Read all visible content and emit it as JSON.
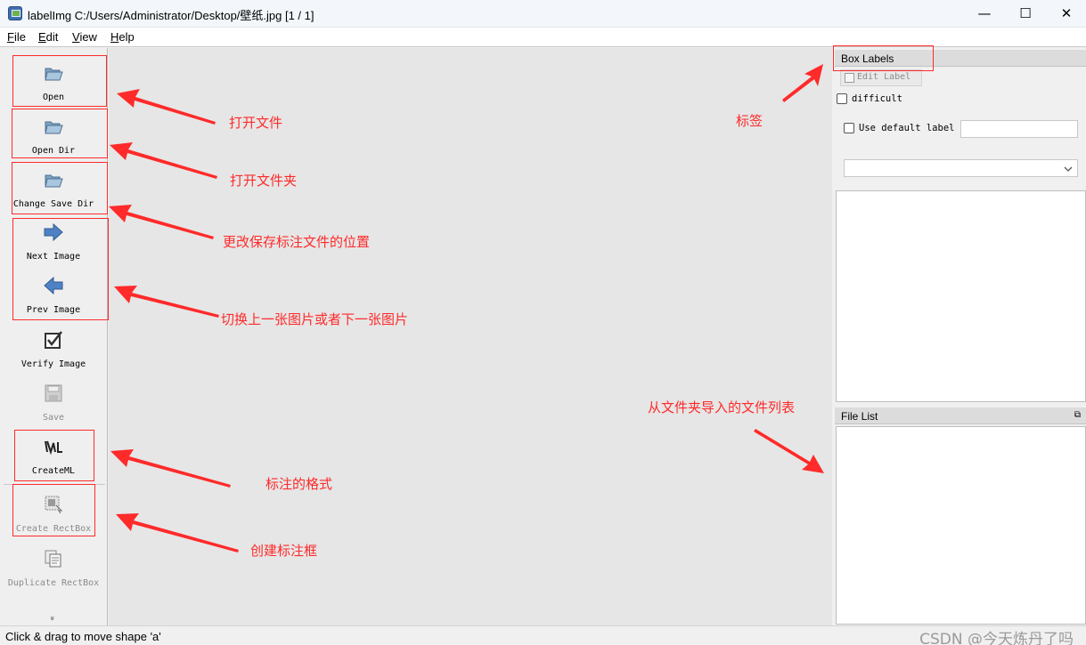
{
  "window": {
    "title": "labelImg C:/Users/Administrator/Desktop/壁纸.jpg [1 / 1]",
    "controls": {
      "minimize": "—",
      "maximize": "☐",
      "close": "✕"
    }
  },
  "menu": [
    {
      "key": "F",
      "rest": "ile"
    },
    {
      "key": "E",
      "rest": "dit"
    },
    {
      "key": "V",
      "rest": "iew"
    },
    {
      "key": "H",
      "rest": "elp"
    }
  ],
  "toolbar": {
    "open": "Open",
    "open_dir": "Open Dir",
    "change_save_dir": "Change Save Dir",
    "next_image": "Next Image",
    "prev_image": "Prev Image",
    "verify_image": "Verify Image",
    "save": "Save",
    "format": "CreateML",
    "create_rectbox": "Create RectBox",
    "duplicate_rectbox": "Duplicate RectBox",
    "more": "»"
  },
  "right_panel": {
    "box_labels_title": "Box Labels",
    "edit_label": "Edit Label",
    "difficult": "difficult",
    "use_default_label": "Use default label",
    "default_label_value": "",
    "file_list_title": "File List",
    "float_icon": "⧉"
  },
  "status": {
    "message": "Click & drag to move shape 'a'",
    "watermark": "CSDN @今天炼丹了吗"
  },
  "annotations": {
    "open_file": "打开文件",
    "open_dir": "打开文件夹",
    "change_save_dir": "更改保存标注文件的位置",
    "switch_image": "切换上一张图片或者下一张图片",
    "format": "标注的格式",
    "create_box": "创建标注框",
    "label": "标签",
    "file_list": "从文件夹导入的文件列表"
  },
  "colors": {
    "annotation": "#ff2a2a",
    "canvas": "#e6e6e6",
    "toolbar": "#efefef"
  }
}
